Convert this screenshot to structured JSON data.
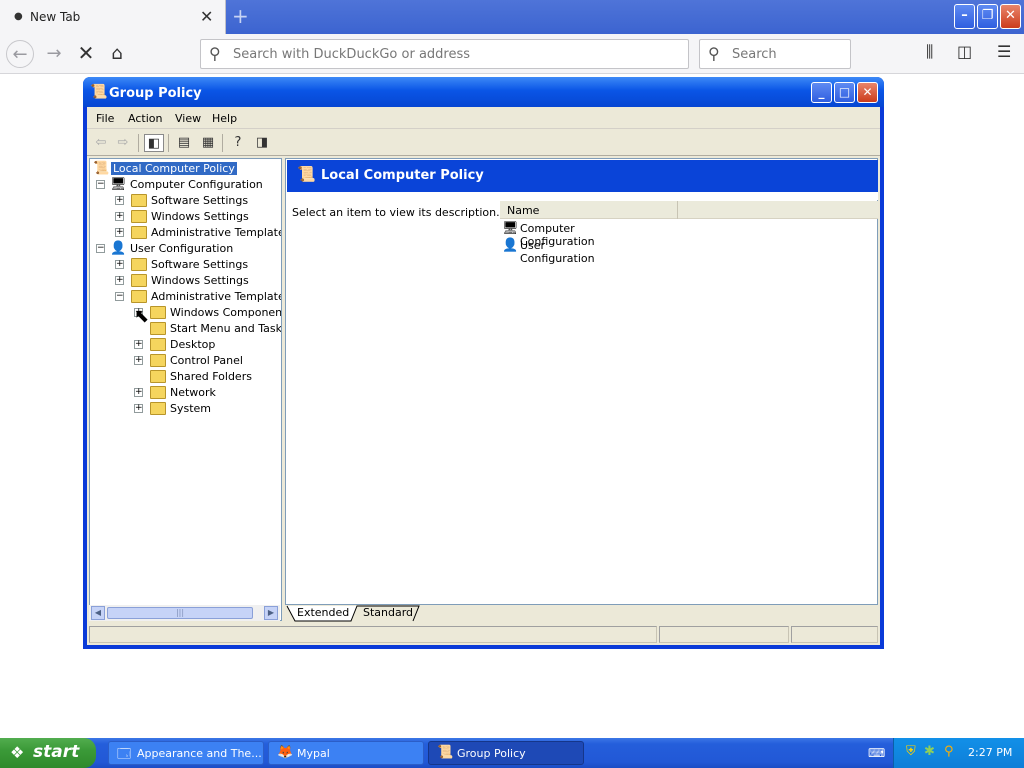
{
  "browser": {
    "tab_title": "New Tab",
    "url_placeholder": "Search with DuckDuckGo or address",
    "search_placeholder": "Search"
  },
  "window": {
    "title": "Group Policy",
    "menu": [
      "File",
      "Action",
      "View",
      "Help"
    ]
  },
  "tree": [
    {
      "label": "Local Computer Policy",
      "selected": true
    },
    {
      "label": "Computer Configuration"
    },
    {
      "label": "Software Settings"
    },
    {
      "label": "Windows Settings"
    },
    {
      "label": "Administrative Templates"
    },
    {
      "label": "User Configuration"
    },
    {
      "label": "Software Settings"
    },
    {
      "label": "Windows Settings"
    },
    {
      "label": "Administrative Templates"
    },
    {
      "label": "Windows Components"
    },
    {
      "label": "Start Menu and Taskbar"
    },
    {
      "label": "Desktop"
    },
    {
      "label": "Control Panel"
    },
    {
      "label": "Shared Folders"
    },
    {
      "label": "Network"
    },
    {
      "label": "System"
    }
  ],
  "details": {
    "banner_title": "Local Computer Policy",
    "description": "Select an item to view its description.",
    "column_name": "Name",
    "items": [
      "Computer Configuration",
      "User Configuration"
    ]
  },
  "tabs": [
    "Extended",
    "Standard"
  ],
  "taskbar": {
    "start": "start",
    "tasks": [
      "Appearance and The...",
      "Mypal",
      "Group Policy"
    ],
    "clock": "2:27 PM"
  }
}
